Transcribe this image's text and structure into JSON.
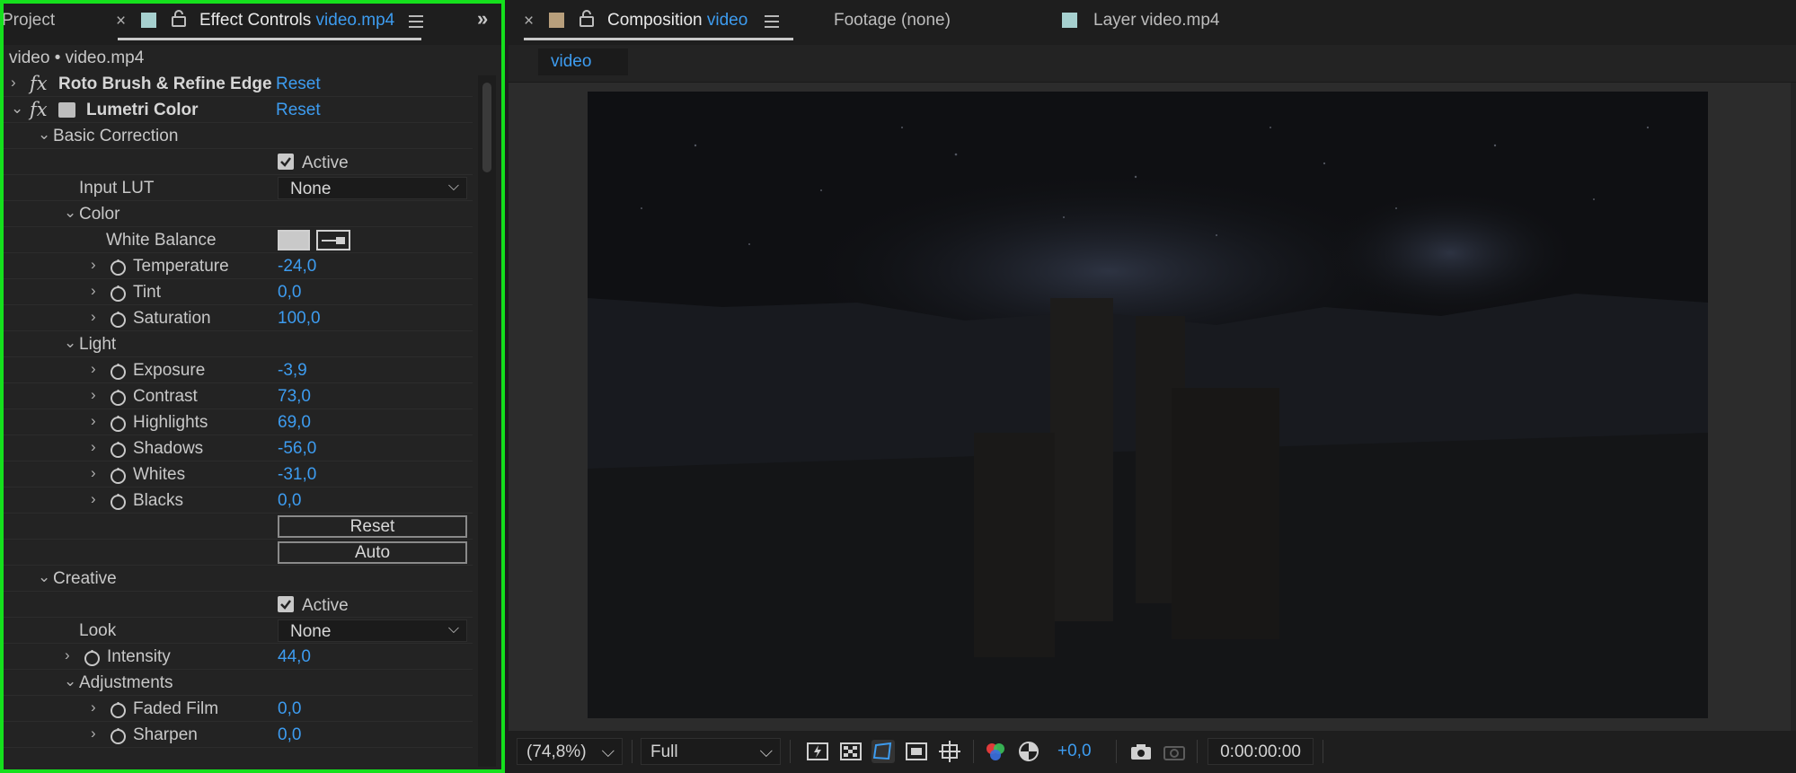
{
  "left_panel": {
    "tabs": {
      "project": "Project",
      "effect_controls": "Effect Controls",
      "effect_controls_target": "video.mp4"
    },
    "path": "video • video.mp4",
    "effects": [
      {
        "name": "Roto Brush & Refine Edge",
        "reset": "Reset"
      },
      {
        "name": "Lumetri Color",
        "reset": "Reset"
      }
    ],
    "basic_correction": {
      "label": "Basic Correction",
      "active_label": "Active",
      "input_lut_label": "Input LUT",
      "input_lut_value": "None",
      "color_label": "Color",
      "white_balance_label": "White Balance",
      "temperature": {
        "label": "Temperature",
        "value": "-24,0"
      },
      "tint": {
        "label": "Tint",
        "value": "0,0"
      },
      "saturation": {
        "label": "Saturation",
        "value": "100,0"
      },
      "light_label": "Light",
      "exposure": {
        "label": "Exposure",
        "value": "-3,9"
      },
      "contrast": {
        "label": "Contrast",
        "value": "73,0"
      },
      "highlights": {
        "label": "Highlights",
        "value": "69,0"
      },
      "shadows": {
        "label": "Shadows",
        "value": "-56,0"
      },
      "whites": {
        "label": "Whites",
        "value": "-31,0"
      },
      "blacks": {
        "label": "Blacks",
        "value": "0,0"
      },
      "reset_button": "Reset",
      "auto_button": "Auto"
    },
    "creative": {
      "label": "Creative",
      "active_label": "Active",
      "look_label": "Look",
      "look_value": "None",
      "intensity": {
        "label": "Intensity",
        "value": "44,0"
      },
      "adjustments_label": "Adjustments",
      "faded_film": {
        "label": "Faded Film",
        "value": "0,0"
      },
      "sharpen": {
        "label": "Sharpen",
        "value": "0,0"
      }
    }
  },
  "right_panel": {
    "tabs": {
      "composition": "Composition",
      "composition_target": "video",
      "footage": "Footage (none)",
      "layer": "Layer video.mp4"
    },
    "subtab": "video",
    "bottom": {
      "zoom": "(74,8%)",
      "resolution": "Full",
      "exposure_value": "+0,0",
      "timecode": "0:00:00:00"
    }
  },
  "colors": {
    "accent": "#3d9cf0",
    "highlight_border": "#15e01d",
    "project_tab_swatch": "#a6d0cf",
    "composition_swatch": "#b89f7c",
    "layer_swatch": "#a6d0cf"
  },
  "icons": [
    "close-icon",
    "lock-icon",
    "panel-menu-icon",
    "expand-panels-icon",
    "stopwatch-icon",
    "eyedropper-icon",
    "chevron-right-icon",
    "chevron-down-icon",
    "fx-icon",
    "checkbox-icon",
    "snapshot-icon",
    "color-channels-icon"
  ]
}
